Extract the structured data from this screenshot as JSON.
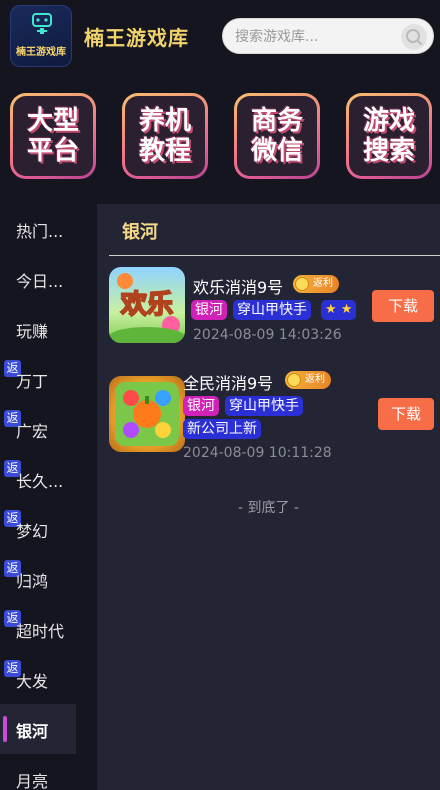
{
  "header": {
    "logo_text": "楠王游戏库",
    "title": "楠王游戏库",
    "search_placeholder": "搜索游戏库...",
    "search_icon": "search-icon"
  },
  "features": [
    {
      "line1": "大型",
      "line2": "平台"
    },
    {
      "line1": "养机",
      "line2": "教程"
    },
    {
      "line1": "商务",
      "line2": "微信"
    },
    {
      "line1": "游戏",
      "line2": "搜索"
    }
  ],
  "sidebar": {
    "badge_label": "返",
    "items": [
      {
        "label": "热门...",
        "badge": false,
        "active": false
      },
      {
        "label": "今日...",
        "badge": false,
        "active": false
      },
      {
        "label": "玩赚",
        "badge": false,
        "active": false
      },
      {
        "label": "万丁",
        "badge": true,
        "active": false
      },
      {
        "label": "广宏",
        "badge": true,
        "active": false
      },
      {
        "label": "长久...",
        "badge": true,
        "active": false
      },
      {
        "label": "梦幻",
        "badge": true,
        "active": false
      },
      {
        "label": "归鸿",
        "badge": true,
        "active": false
      },
      {
        "label": "超时代",
        "badge": true,
        "active": false
      },
      {
        "label": "大发",
        "badge": true,
        "active": false
      },
      {
        "label": "银河",
        "badge": false,
        "active": true
      },
      {
        "label": "月亮",
        "badge": false,
        "active": false
      }
    ]
  },
  "main": {
    "section_title": "银河",
    "fanli_label": "返利",
    "download_label": "下载",
    "games": [
      {
        "name": "欢乐消消9号",
        "thumb_text": "欢乐",
        "tags": [
          {
            "text": "银河",
            "style": "pink"
          },
          {
            "text": "穿山甲快手",
            "style": "blue"
          }
        ],
        "stars": "★ ★",
        "time": "2024-08-09 14:03:26"
      },
      {
        "name": "全民消消9号",
        "tags": [
          {
            "text": "银河",
            "style": "pink"
          },
          {
            "text": "穿山甲快手",
            "style": "blue"
          },
          {
            "text": "新公司上新",
            "style": "blue"
          }
        ],
        "time": "2024-08-09 10:11:28"
      }
    ],
    "end_note": "- 到底了 -"
  },
  "colors": {
    "background": "#15151f",
    "panel": "#232534",
    "accent_gold": "#f2d36b",
    "download_button": "#f76d48",
    "tag_pink": "#d022b8",
    "tag_blue": "#2b2fd6",
    "badge_blue": "#3a4bd8"
  }
}
